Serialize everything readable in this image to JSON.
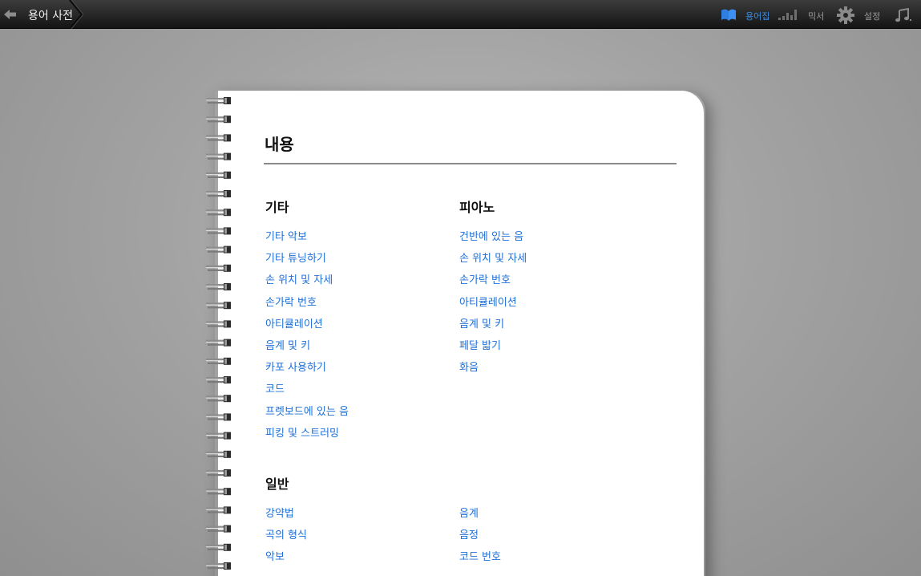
{
  "toolbar": {
    "breadcrumb": "용어 사전",
    "glossary_label": "용어집",
    "mixer_label": "믹서",
    "settings_label": "설정",
    "accent_color": "#3a8ee6"
  },
  "notebook": {
    "title": "내용",
    "sections": {
      "guitar": {
        "heading": "기타",
        "items": [
          "기타 악보",
          "기타 튜닝하기",
          "손 위치 및 자세",
          "손가락 번호",
          "아티큘레이션",
          "음계 및 키",
          "카포 사용하기",
          "코드",
          "프렛보드에 있는 음",
          "피킹 및 스트러밍"
        ]
      },
      "piano": {
        "heading": "피아노",
        "items": [
          "건반에 있는 음",
          "손 위치 및 자세",
          "손가락 번호",
          "아티큘레이션",
          "음계 및 키",
          "페달 밟기",
          "화음"
        ]
      },
      "general": {
        "heading": "일반",
        "items_left": [
          "강약법",
          "곡의 형식",
          "악보"
        ],
        "items_right": [
          "음계",
          "음정",
          "코드 번호"
        ]
      }
    },
    "link_color": "#1e6fd6"
  }
}
